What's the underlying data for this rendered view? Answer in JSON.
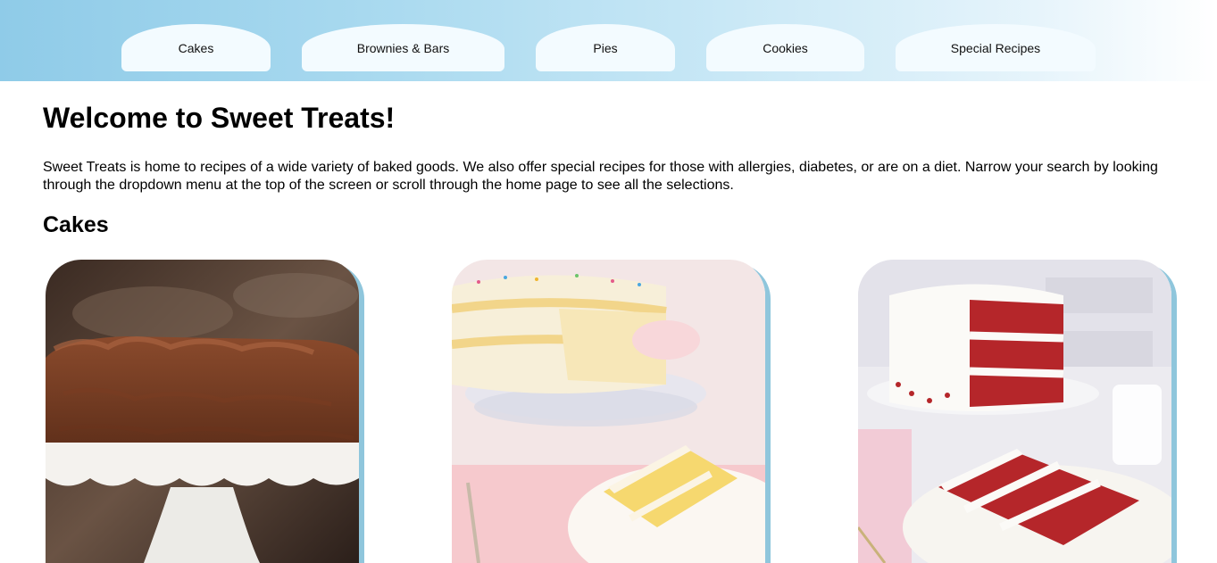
{
  "nav": {
    "items": [
      {
        "label": "Cakes"
      },
      {
        "label": "Brownies & Bars"
      },
      {
        "label": "Pies"
      },
      {
        "label": "Cookies"
      },
      {
        "label": "Special Recipes"
      }
    ]
  },
  "main": {
    "title": "Welcome to Sweet Treats!",
    "intro": "Sweet Treats is home to recipes of a wide variety of baked goods. We also offer special recipes for those with allergies, diabetes, or are on a diet. Narrow your search by looking through the dropdown menu at the top of the screen or scroll through the home page to see all the selections.",
    "sections": [
      {
        "title": "Cakes",
        "cards": [
          {
            "image": "chocolate-cake-photo"
          },
          {
            "image": "vanilla-sprinkle-cake-photo"
          },
          {
            "image": "red-velvet-cake-photo"
          }
        ]
      }
    ]
  },
  "colors": {
    "nav_gradient_start": "#8fcbe8",
    "nav_tab_bg": "#f3fbff",
    "card_shadow": "#8fc6dc"
  }
}
